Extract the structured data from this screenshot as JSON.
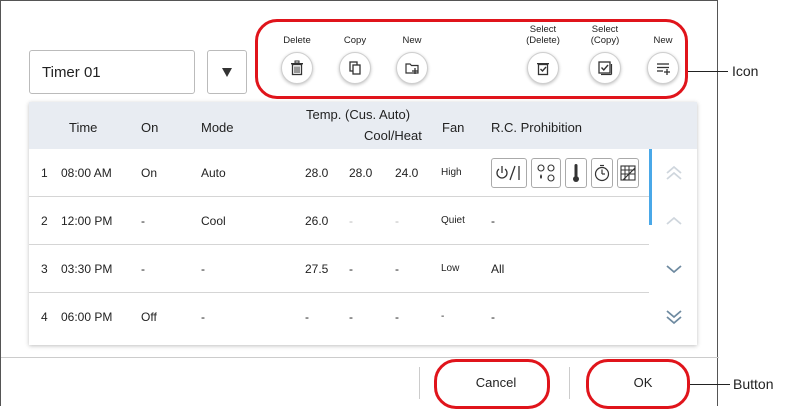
{
  "timer": {
    "name": "Timer 01"
  },
  "toolbar": {
    "delete_label": "Delete",
    "copy_label": "Copy",
    "new_label": "New",
    "select_delete_label": "Select\n(Delete)",
    "select_copy_label": "Select\n(Copy)",
    "new2_label": "New"
  },
  "table": {
    "headers": {
      "time": "Time",
      "on": "On",
      "mode": "Mode",
      "temp_top": "Temp. (Cus. Auto)",
      "temp_bottom": "Cool/Heat",
      "fan": "Fan",
      "rc": "R.C. Prohibition"
    },
    "rows": [
      {
        "num": "1",
        "time": "08:00 AM",
        "on": "On",
        "mode": "Auto",
        "t1": "28.0",
        "t2": "28.0",
        "t3": "24.0",
        "fan": "High",
        "rc": ""
      },
      {
        "num": "2",
        "time": "12:00 PM",
        "on": "-",
        "mode": "Cool",
        "t1": "26.0",
        "t2": "-",
        "t3": "-",
        "fan": "Quiet",
        "rc": "-"
      },
      {
        "num": "3",
        "time": "03:30 PM",
        "on": "-",
        "mode": "-",
        "t1": "27.5",
        "t2": "-",
        "t3": "-",
        "fan": "Low",
        "rc": "All"
      },
      {
        "num": "4",
        "time": "06:00 PM",
        "on": "Off",
        "mode": "-",
        "t1": "-",
        "t2": "-",
        "t3": "-",
        "fan": "-",
        "rc": "-"
      }
    ],
    "rc_icons": [
      "power-onoff-icon",
      "mode-icon",
      "thermometer-icon",
      "timer-icon",
      "filter-icon"
    ],
    "rc_onoff_text": "/|"
  },
  "footer": {
    "cancel_label": "Cancel",
    "ok_label": "OK"
  },
  "callouts": {
    "icon_label": "Icon",
    "button_label": "Button"
  },
  "colors": {
    "highlight": "#e0141b",
    "scroll_accent": "#4aa8e8",
    "header_bg": "#e8ecf2"
  }
}
